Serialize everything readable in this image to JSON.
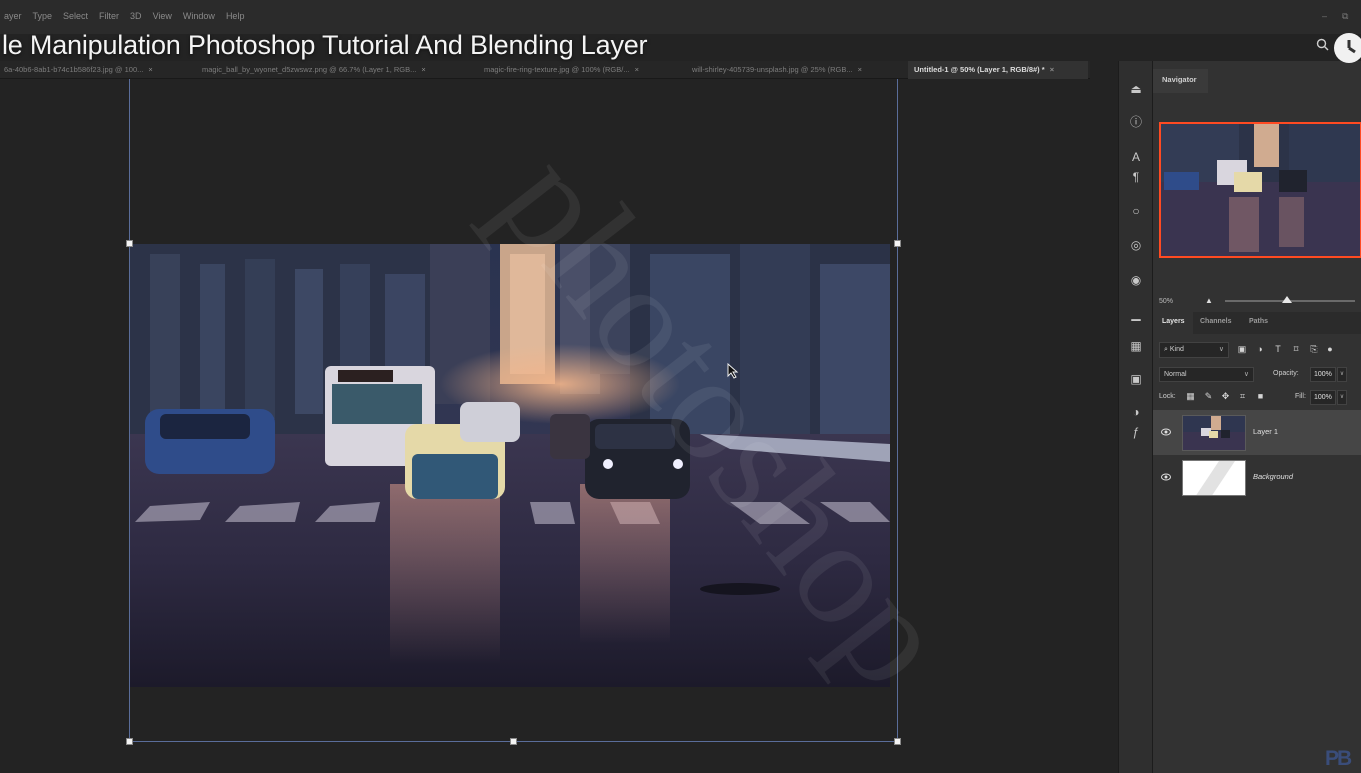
{
  "menu": {
    "items": [
      "ayer",
      "Type",
      "Select",
      "Filter",
      "3D",
      "View",
      "Window",
      "Help"
    ]
  },
  "video_title": "le Manipulation Photoshop Tutorial And Blending Layer",
  "tabs": [
    {
      "label": "6a-40b6-8ab1-b74c1b586f23.jpg @ 100...",
      "close": "×",
      "active": false
    },
    {
      "label": "magic_ball_by_wyonet_d5zwswz.png @ 66.7% (Layer 1, RGB...",
      "close": "×",
      "active": false
    },
    {
      "label": "magic-fire-ring-texture.jpg @ 100% (RGB/...",
      "close": "×",
      "active": false
    },
    {
      "label": "will-shirley-405739-unsplash.jpg @ 25% (RGB...",
      "close": "×",
      "active": false
    },
    {
      "label": "Untitled-1 @ 50% (Layer 1, RGB/8#) *",
      "close": "×",
      "active": true
    }
  ],
  "navigator": {
    "tab_label": "Navigator",
    "zoom": "50%",
    "zoom_fraction": 0.48
  },
  "layers_panel": {
    "tabs": [
      "Layers",
      "Channels",
      "Paths"
    ],
    "active_tab": "Layers",
    "filter_kind": "Kind",
    "blend_mode": "Normal",
    "opacity_label": "Opacity:",
    "opacity_value": "100%",
    "lock_label": "Lock:",
    "fill_label": "Fill:",
    "fill_value": "100%",
    "layers": [
      {
        "name": "Layer 1",
        "selected": true,
        "visible": true
      },
      {
        "name": "Background",
        "selected": false,
        "visible": true
      }
    ]
  },
  "watermark_logo": "PB",
  "watermark_text": "photoshop",
  "colors": {
    "accent_guides": "#5a6d9a",
    "navigator_box": "#ff4a22"
  }
}
